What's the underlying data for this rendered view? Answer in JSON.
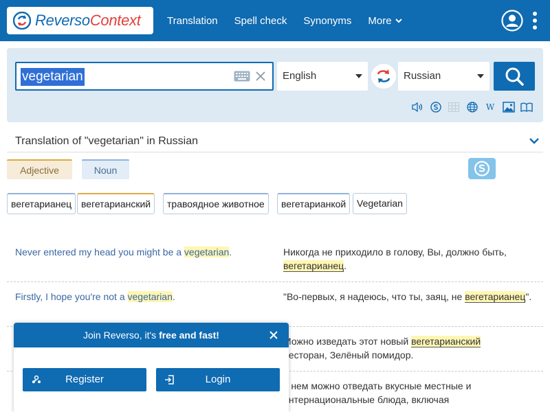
{
  "header": {
    "logo": {
      "part1": "Reverso",
      "part2": "Context"
    },
    "nav": [
      "Translation",
      "Spell check",
      "Synonyms",
      "More"
    ],
    "icons": [
      "user-icon",
      "kebab-menu-icon",
      "chevron-down-icon"
    ]
  },
  "search": {
    "query": "vegetarian",
    "source_lang": "English",
    "target_lang": "Russian",
    "tools": [
      "speaker-icon",
      "skype-icon",
      "grid-icon",
      "globe-icon",
      "W",
      "image-icon",
      "book-icon"
    ]
  },
  "translation": {
    "heading": "Translation of \"vegetarian\" in Russian",
    "pos_tags": [
      "Adjective",
      "Noun"
    ],
    "chips": [
      "вегетарианец",
      "вегетарианский",
      "травоядное животное",
      "вегетарианкой",
      "Vegetarian"
    ]
  },
  "examples": [
    {
      "src_pre": "Never entered my head you might be a ",
      "src_hl": "vegetarian",
      "src_post": ".",
      "tgt_pre": "Никогда не приходило в голову, Вы, должно быть, ",
      "tgt_hl": "вегетарианец",
      "tgt_post": "."
    },
    {
      "src_pre": "Firstly, I hope you're not a ",
      "src_hl": "vegetarian",
      "src_post": ".",
      "tgt_pre": "\"Во-первых, я надеюсь, что ты, заяц, не ",
      "tgt_hl": "вегетарианец",
      "tgt_post": "\"."
    },
    {
      "tgt_pre": "Можно изведать этот новый ",
      "tgt_hl": "вегетарианский",
      "tgt_post": "ресторан, Зелёный помидор."
    },
    {
      "tgt_line1": "в нем можно отведать вкусные местные и",
      "tgt_line2": "интернациональные блюда, включая"
    }
  ],
  "popup": {
    "title_pre": "Join Reverso, it's ",
    "title_bold": "free and fast!",
    "register": "Register",
    "login": "Login"
  },
  "colors": {
    "brand": "#0f6bb2",
    "accent_red": "#e2403a",
    "highlight": "#fef6b3"
  }
}
